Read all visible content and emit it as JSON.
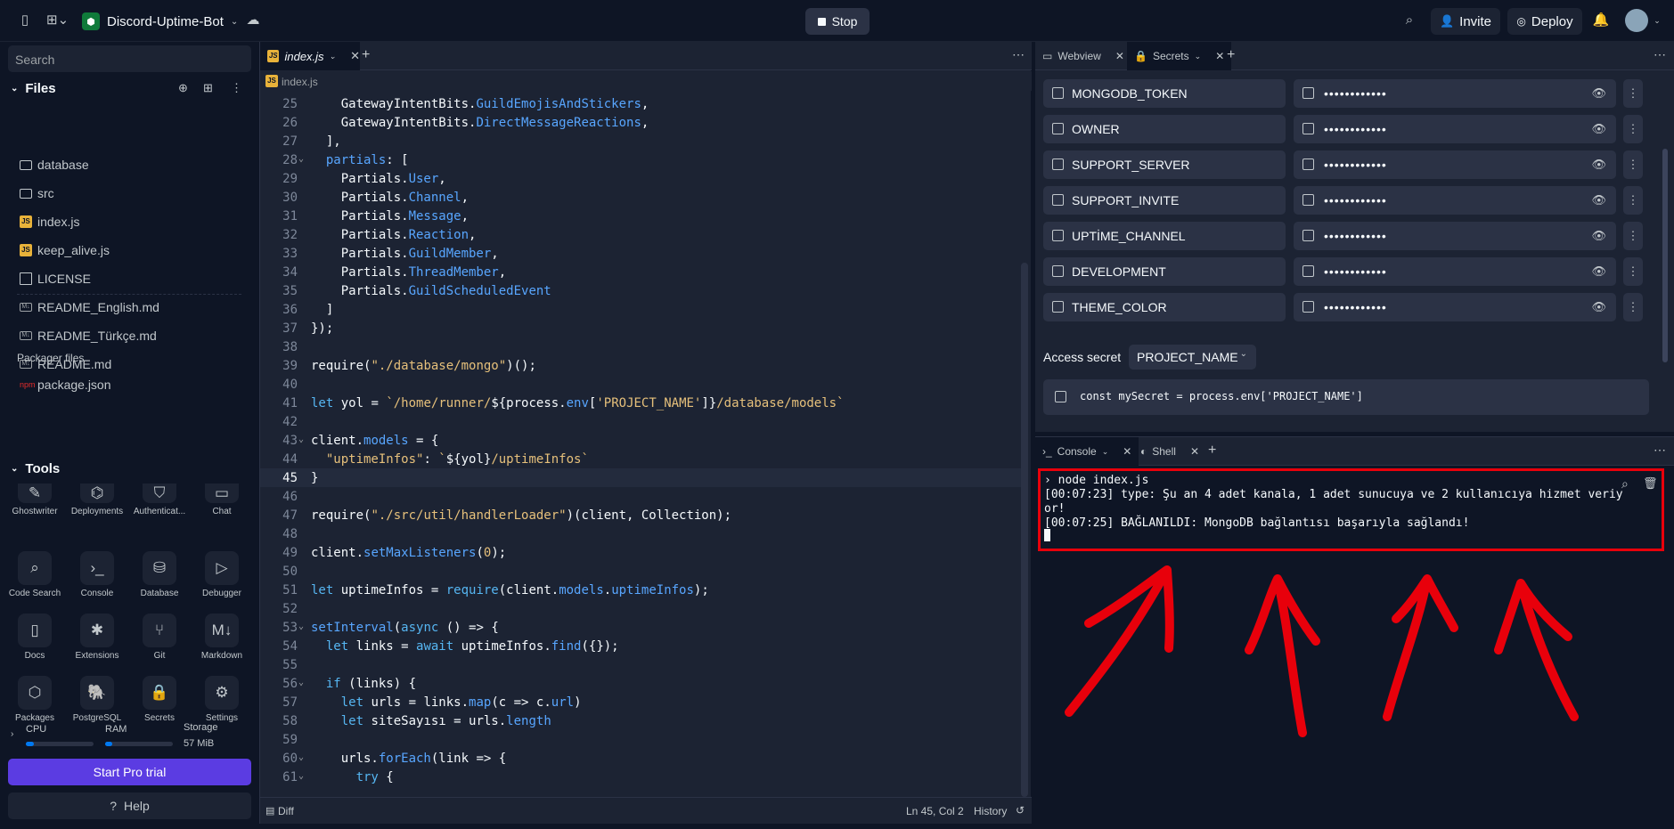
{
  "topbar": {
    "project_name": "Discord-Uptime-Bot",
    "stop_label": "Stop",
    "invite_label": "Invite",
    "deploy_label": "Deploy"
  },
  "sidebar": {
    "search_placeholder": "Search",
    "files_title": "Files",
    "files": [
      {
        "name": "database",
        "icon": "folder-icon"
      },
      {
        "name": "src",
        "icon": "folder-icon"
      },
      {
        "name": "index.js",
        "icon": "js-file-icon"
      },
      {
        "name": "keep_alive.js",
        "icon": "js-file-icon"
      },
      {
        "name": "LICENSE",
        "icon": "file-icon"
      },
      {
        "name": "README_English.md",
        "icon": "markdown-file-icon"
      },
      {
        "name": "README_Türkçe.md",
        "icon": "markdown-file-icon"
      },
      {
        "name": "README.md",
        "icon": "markdown-file-icon"
      }
    ],
    "packager_title": "Packager files",
    "packager_files": [
      {
        "name": "package.json",
        "icon": "npm-icon"
      }
    ],
    "tools_title": "Tools",
    "tools": [
      {
        "label": "Ghostwriter"
      },
      {
        "label": "Deployments"
      },
      {
        "label": "Authenticat..."
      },
      {
        "label": "Chat"
      },
      {
        "label": "Code Search"
      },
      {
        "label": "Console"
      },
      {
        "label": "Database"
      },
      {
        "label": "Debugger"
      },
      {
        "label": "Docs"
      },
      {
        "label": "Extensions"
      },
      {
        "label": "Git"
      },
      {
        "label": "Markdown"
      },
      {
        "label": "Packages"
      },
      {
        "label": "PostgreSQL"
      },
      {
        "label": "Secrets"
      },
      {
        "label": "Settings"
      }
    ],
    "resources": {
      "cpu_label": "CPU",
      "cpu_fraction": 0.12,
      "ram_label": "RAM",
      "ram_fraction": 0.1,
      "storage_label": "Storage",
      "storage_value": "57 MiB"
    },
    "pro_trial_label": "Start Pro trial",
    "help_label": "Help"
  },
  "editor": {
    "tab_label": "index.js",
    "breadcrumb": "index.js",
    "lines": [
      {
        "n": "25",
        "fold": "",
        "segs": [
          [
            "tx",
            "    GatewayIntentBits."
          ],
          [
            "pr",
            "GuildEmojisAndStickers"
          ],
          [
            "tx",
            ","
          ]
        ]
      },
      {
        "n": "26",
        "fold": "",
        "segs": [
          [
            "tx",
            "    GatewayIntentBits."
          ],
          [
            "pr",
            "DirectMessageReactions"
          ],
          [
            "tx",
            ","
          ]
        ]
      },
      {
        "n": "27",
        "fold": "",
        "segs": [
          [
            "tx",
            "  ],"
          ]
        ]
      },
      {
        "n": "28",
        "fold": "⌄",
        "segs": [
          [
            "tx",
            "  "
          ],
          [
            "pr",
            "partials"
          ],
          [
            "tx",
            ": ["
          ]
        ]
      },
      {
        "n": "29",
        "fold": "",
        "segs": [
          [
            "tx",
            "    Partials."
          ],
          [
            "pr",
            "User"
          ],
          [
            "tx",
            ","
          ]
        ]
      },
      {
        "n": "30",
        "fold": "",
        "segs": [
          [
            "tx",
            "    Partials."
          ],
          [
            "pr",
            "Channel"
          ],
          [
            "tx",
            ","
          ]
        ]
      },
      {
        "n": "31",
        "fold": "",
        "segs": [
          [
            "tx",
            "    Partials."
          ],
          [
            "pr",
            "Message"
          ],
          [
            "tx",
            ","
          ]
        ]
      },
      {
        "n": "32",
        "fold": "",
        "segs": [
          [
            "tx",
            "    Partials."
          ],
          [
            "pr",
            "Reaction"
          ],
          [
            "tx",
            ","
          ]
        ]
      },
      {
        "n": "33",
        "fold": "",
        "segs": [
          [
            "tx",
            "    Partials."
          ],
          [
            "pr",
            "GuildMember"
          ],
          [
            "tx",
            ","
          ]
        ]
      },
      {
        "n": "34",
        "fold": "",
        "segs": [
          [
            "tx",
            "    Partials."
          ],
          [
            "pr",
            "ThreadMember"
          ],
          [
            "tx",
            ","
          ]
        ]
      },
      {
        "n": "35",
        "fold": "",
        "segs": [
          [
            "tx",
            "    Partials."
          ],
          [
            "pr",
            "GuildScheduledEvent"
          ]
        ]
      },
      {
        "n": "36",
        "fold": "",
        "segs": [
          [
            "tx",
            "  ]"
          ]
        ]
      },
      {
        "n": "37",
        "fold": "",
        "segs": [
          [
            "tx",
            "});"
          ]
        ]
      },
      {
        "n": "38",
        "fold": "",
        "segs": []
      },
      {
        "n": "39",
        "fold": "",
        "segs": [
          [
            "tx",
            "require("
          ],
          [
            "st",
            "\"./database/mongo\""
          ],
          [
            "tx",
            ")();"
          ]
        ]
      },
      {
        "n": "40",
        "fold": "",
        "segs": []
      },
      {
        "n": "41",
        "fold": "",
        "segs": [
          [
            "kw",
            "let"
          ],
          [
            "tx",
            " yol = "
          ],
          [
            "st",
            "`/home/runner/"
          ],
          [
            "tx",
            "${process."
          ],
          [
            "pr",
            "env"
          ],
          [
            "tx",
            "["
          ],
          [
            "st",
            "'PROJECT_NAME'"
          ],
          [
            "tx",
            "]}"
          ],
          [
            "st",
            "/database/models`"
          ]
        ]
      },
      {
        "n": "42",
        "fold": "",
        "segs": []
      },
      {
        "n": "43",
        "fold": "⌄",
        "segs": [
          [
            "tx",
            "client."
          ],
          [
            "pr",
            "models"
          ],
          [
            "tx",
            " = {"
          ]
        ]
      },
      {
        "n": "44",
        "fold": "",
        "segs": [
          [
            "tx",
            "  "
          ],
          [
            "st",
            "\"uptimeInfos\""
          ],
          [
            "tx",
            ": "
          ],
          [
            "st",
            "`"
          ],
          [
            "tx",
            "${yol}"
          ],
          [
            "st",
            "/uptimeInfos`"
          ]
        ]
      },
      {
        "n": "45",
        "fold": "",
        "segs": [
          [
            "tx",
            "}"
          ]
        ]
      },
      {
        "n": "46",
        "fold": "",
        "segs": []
      },
      {
        "n": "47",
        "fold": "",
        "segs": [
          [
            "tx",
            "require("
          ],
          [
            "st",
            "\"./src/util/handlerLoader\""
          ],
          [
            "tx",
            ")(client, Collection);"
          ]
        ]
      },
      {
        "n": "48",
        "fold": "",
        "segs": []
      },
      {
        "n": "49",
        "fold": "",
        "segs": [
          [
            "tx",
            "client."
          ],
          [
            "pr",
            "setMaxListeners"
          ],
          [
            "tx",
            "("
          ],
          [
            "st",
            "0"
          ],
          [
            "tx",
            ");"
          ]
        ]
      },
      {
        "n": "50",
        "fold": "",
        "segs": []
      },
      {
        "n": "51",
        "fold": "",
        "segs": [
          [
            "kw",
            "let"
          ],
          [
            "tx",
            " uptimeInfos = "
          ],
          [
            "kw",
            "require"
          ],
          [
            "tx",
            "(client."
          ],
          [
            "pr",
            "models"
          ],
          [
            "tx",
            "."
          ],
          [
            "pr",
            "uptimeInfos"
          ],
          [
            "tx",
            ");"
          ]
        ]
      },
      {
        "n": "52",
        "fold": "",
        "segs": []
      },
      {
        "n": "53",
        "fold": "⌄",
        "segs": [
          [
            "pr",
            "setInterval"
          ],
          [
            "tx",
            "("
          ],
          [
            "kw",
            "async"
          ],
          [
            "tx",
            " () => {"
          ]
        ]
      },
      {
        "n": "54",
        "fold": "",
        "segs": [
          [
            "tx",
            "  "
          ],
          [
            "kw",
            "let"
          ],
          [
            "tx",
            " links = "
          ],
          [
            "kw",
            "await"
          ],
          [
            "tx",
            " uptimeInfos."
          ],
          [
            "pr",
            "find"
          ],
          [
            "tx",
            "({});"
          ]
        ]
      },
      {
        "n": "55",
        "fold": "",
        "segs": []
      },
      {
        "n": "56",
        "fold": "⌄",
        "segs": [
          [
            "tx",
            "  "
          ],
          [
            "kw",
            "if"
          ],
          [
            "tx",
            " (links) {"
          ]
        ]
      },
      {
        "n": "57",
        "fold": "",
        "segs": [
          [
            "tx",
            "    "
          ],
          [
            "kw",
            "let"
          ],
          [
            "tx",
            " urls = links."
          ],
          [
            "pr",
            "map"
          ],
          [
            "tx",
            "(c => c."
          ],
          [
            "pr",
            "url"
          ],
          [
            "tx",
            ")"
          ]
        ]
      },
      {
        "n": "58",
        "fold": "",
        "segs": [
          [
            "tx",
            "    "
          ],
          [
            "kw",
            "let"
          ],
          [
            "tx",
            " siteSayısı = urls."
          ],
          [
            "pr",
            "length"
          ]
        ]
      },
      {
        "n": "59",
        "fold": "",
        "segs": []
      },
      {
        "n": "60",
        "fold": "⌄",
        "segs": [
          [
            "tx",
            "    urls."
          ],
          [
            "pr",
            "forEach"
          ],
          [
            "tx",
            "(link => {"
          ]
        ]
      },
      {
        "n": "61",
        "fold": "⌄",
        "segs": [
          [
            "tx",
            "      "
          ],
          [
            "kw",
            "try"
          ],
          [
            "tx",
            " {"
          ]
        ]
      }
    ],
    "status": {
      "diff_label": "Diff",
      "cursor": "Ln 45, Col 2",
      "history_label": "History"
    }
  },
  "right_top": {
    "tabs": [
      {
        "label": "Webview"
      },
      {
        "label": "Secrets"
      }
    ],
    "secrets": [
      {
        "name": "MONGODB_TOKEN",
        "value": "••••••••••••"
      },
      {
        "name": "OWNER",
        "value": "••••••••••••"
      },
      {
        "name": "SUPPORT_SERVER",
        "value": "••••••••••••"
      },
      {
        "name": "SUPPORT_INVITE",
        "value": "••••••••••••"
      },
      {
        "name": "UPTİME_CHANNEL",
        "value": "••••••••••••"
      },
      {
        "name": "DEVELOPMENT",
        "value": "••••••••••••"
      },
      {
        "name": "THEME_COLOR",
        "value": "••••••••••••"
      }
    ],
    "access_label": "Access secret",
    "access_selected": "PROJECT_NAME",
    "access_code": "const mySecret = process.env['PROJECT_NAME']"
  },
  "right_bottom": {
    "tabs": [
      {
        "label": "Console"
      },
      {
        "label": "Shell"
      }
    ],
    "console_lines": [
      "› node index.js",
      "[00:07:23] type: Şu an 4 adet kanala, 1 adet sunucuya ve 2 kullanıcıya hizmet veriy",
      "or!",
      "[00:07:25] BAĞLANILDI: MongoDB bağlantısı başarıyla sağlandı!"
    ]
  },
  "colors": {
    "accent": "#5b3ce2",
    "annotation": "#e8000b"
  }
}
